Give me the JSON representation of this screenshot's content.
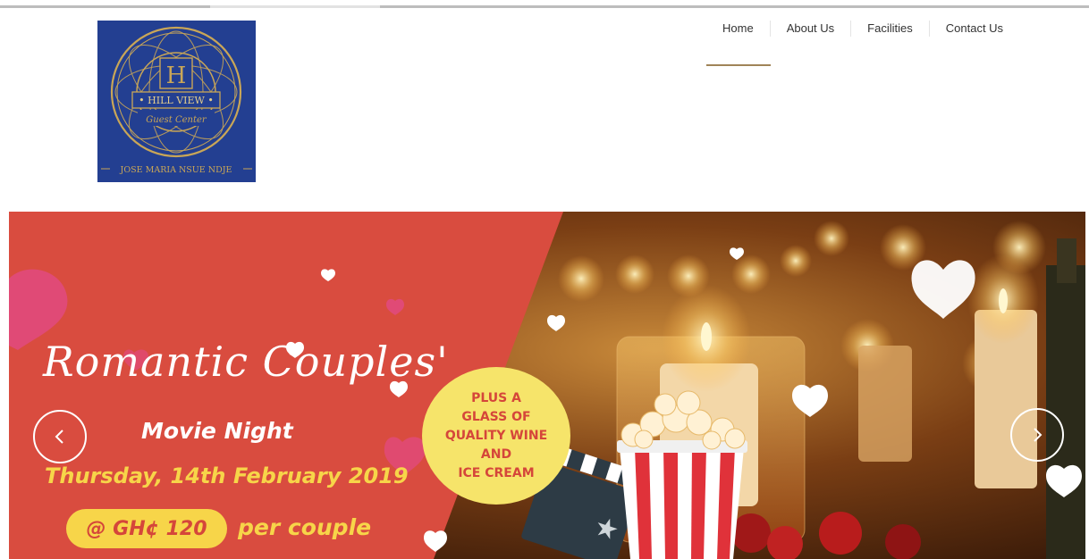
{
  "logo": {
    "letter": "H",
    "name": "• HILL VIEW •",
    "tagline": "Guest Center",
    "owner": "JOSE MARIA NSUE NDJE"
  },
  "nav": {
    "items": [
      {
        "label": "Home",
        "active": true
      },
      {
        "label": "About Us"
      },
      {
        "label": "Facilities"
      },
      {
        "label": "Contact Us"
      }
    ]
  },
  "banner": {
    "title": "Romantic Couples'",
    "subtitle": "Movie Night",
    "date": "Thursday, 14th February 2019",
    "price": "@ GH¢ 120",
    "per": "per couple",
    "promo": [
      "PLUS A",
      "GLASS OF",
      "QUALITY WINE",
      "AND",
      "ICE CREAM"
    ]
  },
  "slider": {
    "prev_icon": "chevron-left-icon",
    "next_icon": "chevron-right-icon"
  },
  "colors": {
    "logo_bg": "#233f91",
    "logo_gold": "#c9a657",
    "banner_red": "#d94c3f",
    "banner_yellow": "#f7d549",
    "nav_active": "#a08458"
  }
}
